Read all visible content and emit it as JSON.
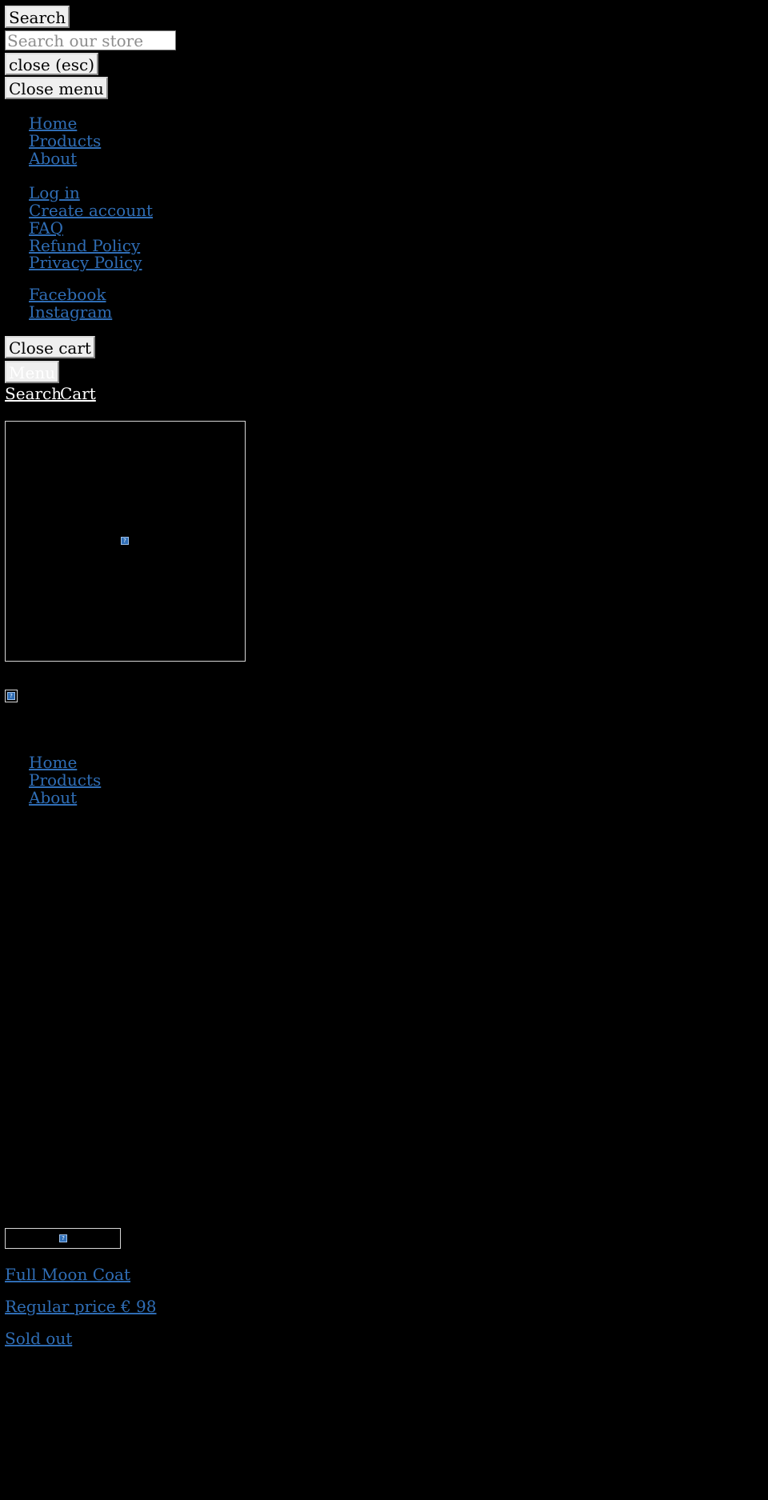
{
  "search_drawer": {
    "submit_label": "Search",
    "input_placeholder": "Search our store",
    "close_label": "close (esc)"
  },
  "menu_drawer": {
    "close_label": "Close menu",
    "primary_links": [
      "Home",
      "Products",
      "About"
    ],
    "secondary_links": [
      "Log in",
      "Create account",
      "FAQ",
      "Refund Policy",
      "Privacy Policy"
    ],
    "social_links": [
      "Facebook",
      "Instagram"
    ]
  },
  "cart_drawer": {
    "close_label": "Close cart"
  },
  "header": {
    "menu_label": "Menu",
    "search_link": "Search",
    "cart_link": "Cart"
  },
  "main_nav": {
    "links": [
      "Home",
      "Products",
      "About"
    ]
  },
  "product_card": {
    "title": "Full Moon Coat",
    "price": "Regular price € 98",
    "status": "Sold out"
  },
  "icons": {
    "broken_image": "broken-image-icon"
  },
  "colors": {
    "background": "#000000",
    "link": "#2f6db5",
    "button_bg": "#efefef"
  }
}
